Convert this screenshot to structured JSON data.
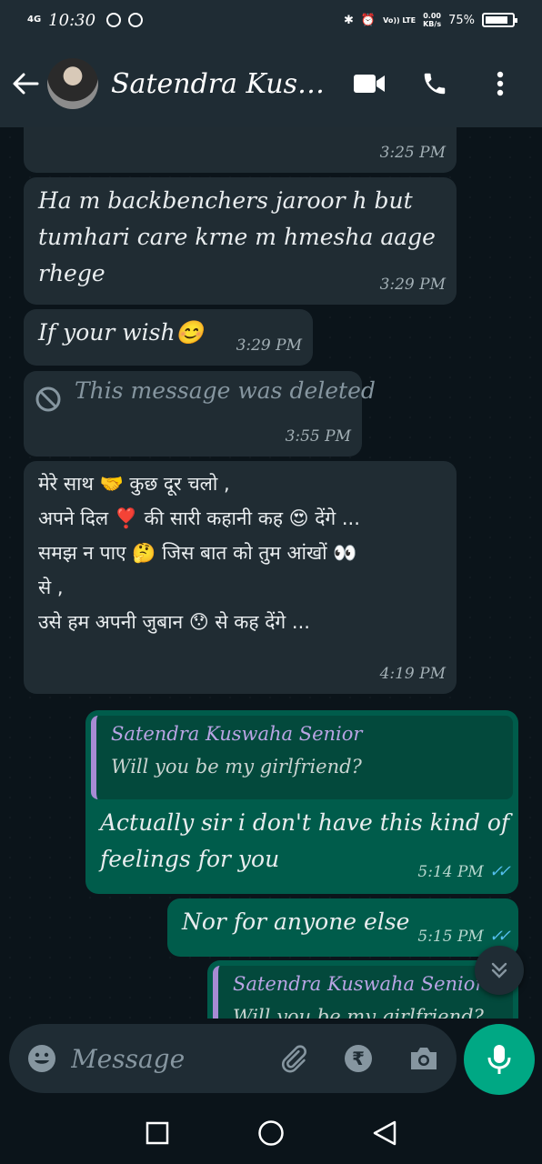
{
  "status_bar": {
    "network": "4G",
    "time": "10:30",
    "volte": "Vo)) LTE",
    "speed_value": "0.00",
    "speed_unit": "KB/s",
    "battery": "75%"
  },
  "header": {
    "contact_name": "Satendra Kuswa..."
  },
  "messages": [
    {
      "direction": "in",
      "text": "",
      "time": "3:25 PM"
    },
    {
      "direction": "in",
      "text_lines": [
        "Ha m backbenchers jaroor h but",
        "tumhari care krne m hmesha aage rhege"
      ],
      "time": "3:29 PM"
    },
    {
      "direction": "in",
      "text": "If your wish😊",
      "time": "3:29 PM"
    },
    {
      "direction": "in",
      "deleted": true,
      "text": "This message was deleted",
      "time": "3:55 PM"
    },
    {
      "direction": "in",
      "text_lines": [
        "मेरे साथ 🤝 कुछ दूर चलो ,",
        "अपने दिल ❣️ की सारी कहानी कह 😍 देंगे ...",
        "समझ न पाए 🤔 जिस बात को तुम आंखों 👀",
        "से ,",
        "उसे हम अपनी जुबान 😯 से कह देंगे ..."
      ],
      "time": "4:19 PM"
    },
    {
      "direction": "out",
      "quote": {
        "name": "Satendra Kuswaha Senior",
        "text": "Will you be my girlfriend?"
      },
      "text_lines": [
        "Actually sir i don't have this kind of",
        "feelings for you"
      ],
      "time": "5:14 PM",
      "ticks": "✓✓"
    },
    {
      "direction": "out",
      "text": "Nor for anyone else",
      "time": "5:15 PM",
      "ticks": "✓✓"
    },
    {
      "direction": "out",
      "quote": {
        "name": "Satendra Kuswaha Senior",
        "text": "Will you be my girlfriend?"
      }
    }
  ],
  "input": {
    "placeholder": "Message"
  },
  "icons": {
    "back": "arrow-left-icon",
    "video": "video-call-icon",
    "call": "phone-icon",
    "menu": "more-vert-icon",
    "emoji": "emoji-icon",
    "attach": "paperclip-icon",
    "payment": "rupee-icon",
    "camera": "camera-icon",
    "mic": "microphone-icon"
  },
  "colors": {
    "incoming_bubble": "#202c33",
    "outgoing_bubble": "#005c4b",
    "accent": "#00a884",
    "read_ticks": "#53bdeb"
  }
}
